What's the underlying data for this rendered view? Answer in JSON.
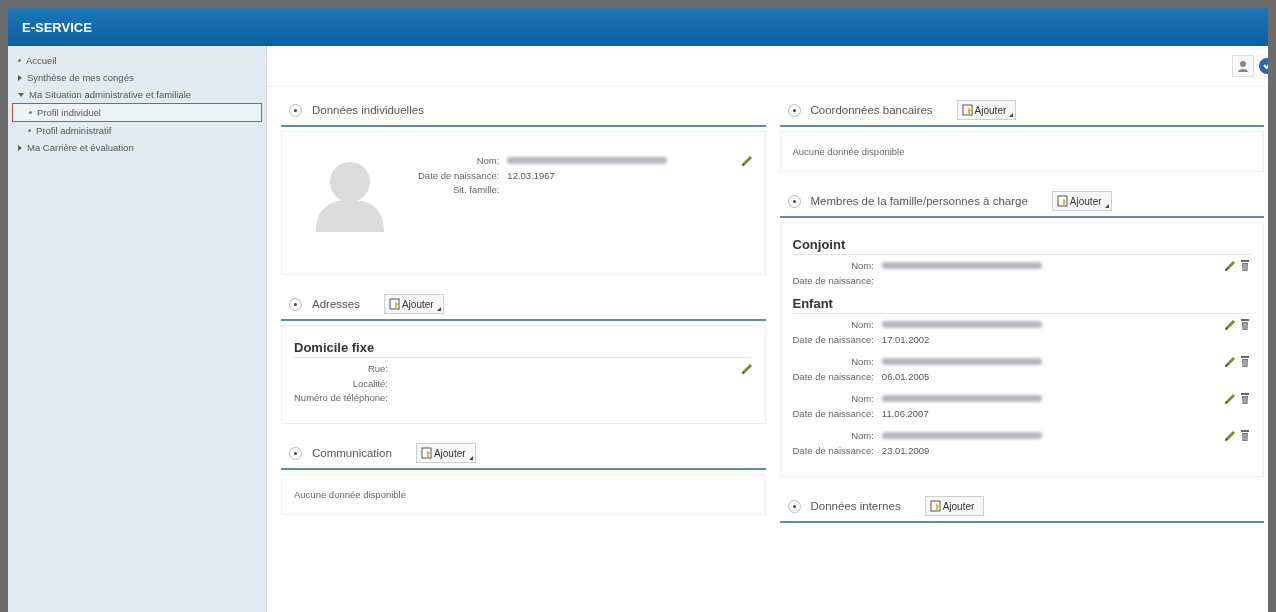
{
  "header": {
    "title": "E-SERVICE"
  },
  "sidebar": {
    "items": [
      {
        "label": "Accueil",
        "kind": "leaf",
        "selected": false
      },
      {
        "label": "Synthèse de mes congés",
        "kind": "folder",
        "expanded": false,
        "selected": false
      },
      {
        "label": "Ma Situation administrative et familiale",
        "kind": "folder",
        "expanded": true,
        "selected": false,
        "children": [
          {
            "label": "Profil individuel",
            "kind": "leaf",
            "selected": true
          },
          {
            "label": "Profil administratif",
            "kind": "leaf",
            "selected": false
          }
        ]
      },
      {
        "label": "Ma Carrière et évaluation",
        "kind": "folder",
        "expanded": false,
        "selected": false
      }
    ]
  },
  "columns": [
    [
      {
        "kind": "profile",
        "title": "Données individuelles",
        "fields": [
          {
            "label": "Nom:",
            "kind": "blurred"
          },
          {
            "label": "Date de naissance:",
            "kind": "text",
            "value": "12.03.1967"
          },
          {
            "label": "Sit. famille:",
            "kind": "empty"
          }
        ]
      },
      {
        "kind": "records",
        "title": "Adresses",
        "add": {
          "label": "Ajouter",
          "menu": true
        },
        "groups": [
          {
            "heading": "Domicile fixe",
            "entries": [
              {
                "delete": false,
                "fields": [
                  {
                    "label": "Rue:",
                    "kind": "empty"
                  },
                  {
                    "label": "Localité:",
                    "kind": "empty"
                  },
                  {
                    "label": "Numéro de téléphone:",
                    "kind": "empty"
                  }
                ]
              }
            ]
          }
        ]
      },
      {
        "kind": "empty",
        "title": "Communication",
        "add": {
          "label": "Ajouter",
          "menu": true
        },
        "message": "Aucune donnée disponible"
      }
    ],
    [
      {
        "kind": "empty",
        "title": "Coordonnées bancaires",
        "add": {
          "label": "Ajouter",
          "menu": true
        },
        "message": "Aucune donnée disponible"
      },
      {
        "kind": "records",
        "title": "Membres de la famille/personnes à charge",
        "add": {
          "label": "Ajouter",
          "menu": true
        },
        "groups": [
          {
            "heading": "Conjoint",
            "entries": [
              {
                "delete": true,
                "fields": [
                  {
                    "label": "Nom:",
                    "kind": "blurred"
                  },
                  {
                    "label": "Date de naissance:",
                    "kind": "empty"
                  }
                ]
              }
            ]
          },
          {
            "heading": "Enfant",
            "entries": [
              {
                "delete": true,
                "fields": [
                  {
                    "label": "Nom:",
                    "kind": "blurred"
                  },
                  {
                    "label": "Date de naissance:",
                    "kind": "text",
                    "value": "17.01.2002"
                  }
                ]
              },
              {
                "delete": true,
                "fields": [
                  {
                    "label": "Nom:",
                    "kind": "blurred"
                  },
                  {
                    "label": "Date de naissance:",
                    "kind": "text",
                    "value": "06.01.2005"
                  }
                ]
              },
              {
                "delete": true,
                "fields": [
                  {
                    "label": "Nom:",
                    "kind": "blurred"
                  },
                  {
                    "label": "Date de naissance:",
                    "kind": "text",
                    "value": "11.06.2007"
                  }
                ]
              },
              {
                "delete": true,
                "fields": [
                  {
                    "label": "Nom:",
                    "kind": "blurred"
                  },
                  {
                    "label": "Date de naissance:",
                    "kind": "text",
                    "value": "23.01.2009"
                  }
                ]
              }
            ]
          }
        ]
      },
      {
        "kind": "header",
        "title": "Données internes",
        "add": {
          "label": "Ajouter",
          "menu": false
        }
      }
    ]
  ]
}
